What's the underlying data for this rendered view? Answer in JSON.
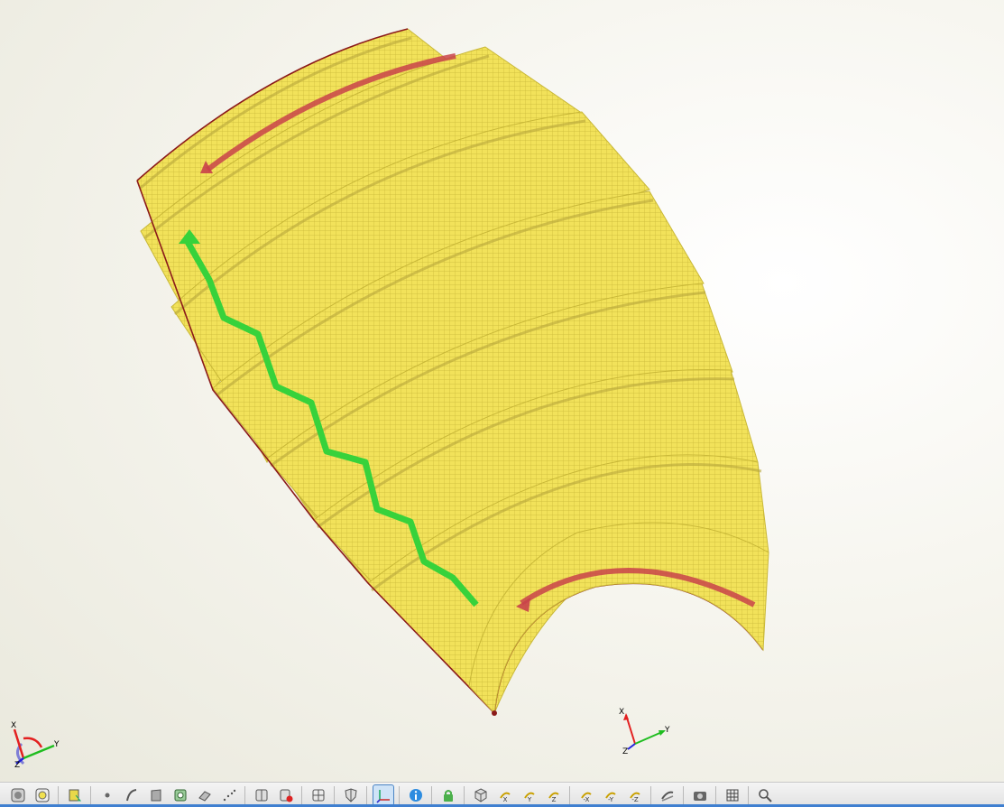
{
  "viewport": {
    "background_color": "#f4f3ea",
    "mesh_color": "#f2e25a",
    "mesh_line_color": "#c9b838",
    "edge_color": "#8b1a1a",
    "seam_color": "#37d23b",
    "direction_arrow_color": "#c9434a",
    "panel_count": 7
  },
  "triad_corner": {
    "x_label": "X",
    "y_label": "Y",
    "z_label": "Z"
  },
  "triad_center": {
    "x_label": "X",
    "y_label": "Y",
    "z_label": "Z"
  },
  "toolbar": {
    "buttons": [
      {
        "name": "display-shaded-button",
        "icon": "shaded-icon"
      },
      {
        "name": "display-transparent-button",
        "icon": "transparent-icon"
      },
      {
        "name": "select-part-button",
        "icon": "select-part-icon"
      },
      {
        "name": "point-button",
        "icon": "point-icon"
      },
      {
        "name": "curve-button",
        "icon": "curve-icon"
      },
      {
        "name": "surface-button",
        "icon": "surface-icon"
      },
      {
        "name": "face-button",
        "icon": "face-icon"
      },
      {
        "name": "solid-button",
        "icon": "solid-icon"
      },
      {
        "name": "dotted-line-button",
        "icon": "dotted-line-icon"
      },
      {
        "name": "section-view-button",
        "icon": "section-icon"
      },
      {
        "name": "delete-section-button",
        "icon": "delete-section-icon"
      },
      {
        "name": "multi-view-button",
        "icon": "multiview-icon"
      },
      {
        "name": "shield-button",
        "icon": "shield-icon"
      },
      {
        "name": "axis-display-button",
        "icon": "axis-icon",
        "active": true
      },
      {
        "name": "info-button",
        "icon": "info-icon"
      },
      {
        "name": "lock-button",
        "icon": "lock-icon"
      },
      {
        "name": "iso-view-button",
        "icon": "iso-cube-icon"
      },
      {
        "name": "view-x-button",
        "icon": "view-x-icon",
        "label": "X"
      },
      {
        "name": "view-y-button",
        "icon": "view-y-icon",
        "label": "Y"
      },
      {
        "name": "view-z-button",
        "icon": "view-z-icon",
        "label": "Z"
      },
      {
        "name": "view-neg-x-button",
        "icon": "view-neg-x-icon",
        "label": "-X"
      },
      {
        "name": "view-neg-y-button",
        "icon": "view-neg-y-icon",
        "label": "-Y"
      },
      {
        "name": "view-neg-z-button",
        "icon": "view-neg-z-icon",
        "label": "-Z"
      },
      {
        "name": "flip-view-button",
        "icon": "flip-icon"
      },
      {
        "name": "screenshot-button",
        "icon": "camera-icon"
      },
      {
        "name": "grid-button",
        "icon": "grid-icon"
      },
      {
        "name": "zoom-button",
        "icon": "magnifier-icon"
      }
    ]
  }
}
